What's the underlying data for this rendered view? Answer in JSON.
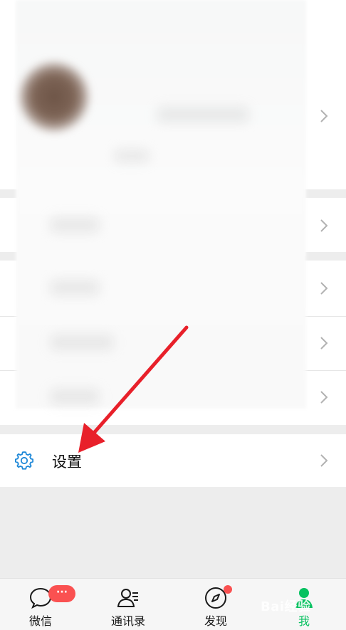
{
  "settings": {
    "label": "设置"
  },
  "tabbar": {
    "tabs": [
      {
        "label": "微信",
        "icon": "chat-bubble-icon",
        "active": false
      },
      {
        "label": "通讯录",
        "icon": "contacts-icon",
        "active": false
      },
      {
        "label": "发现",
        "icon": "compass-icon",
        "active": false
      },
      {
        "label": "我",
        "icon": "person-icon",
        "active": true
      }
    ],
    "chat_badge": "···"
  },
  "watermark": "Bai经验",
  "colors": {
    "accent_green": "#07c160",
    "badge_red": "#fa5151",
    "settings_icon_blue": "#1e88d8",
    "annotation_arrow": "#e8202a"
  }
}
